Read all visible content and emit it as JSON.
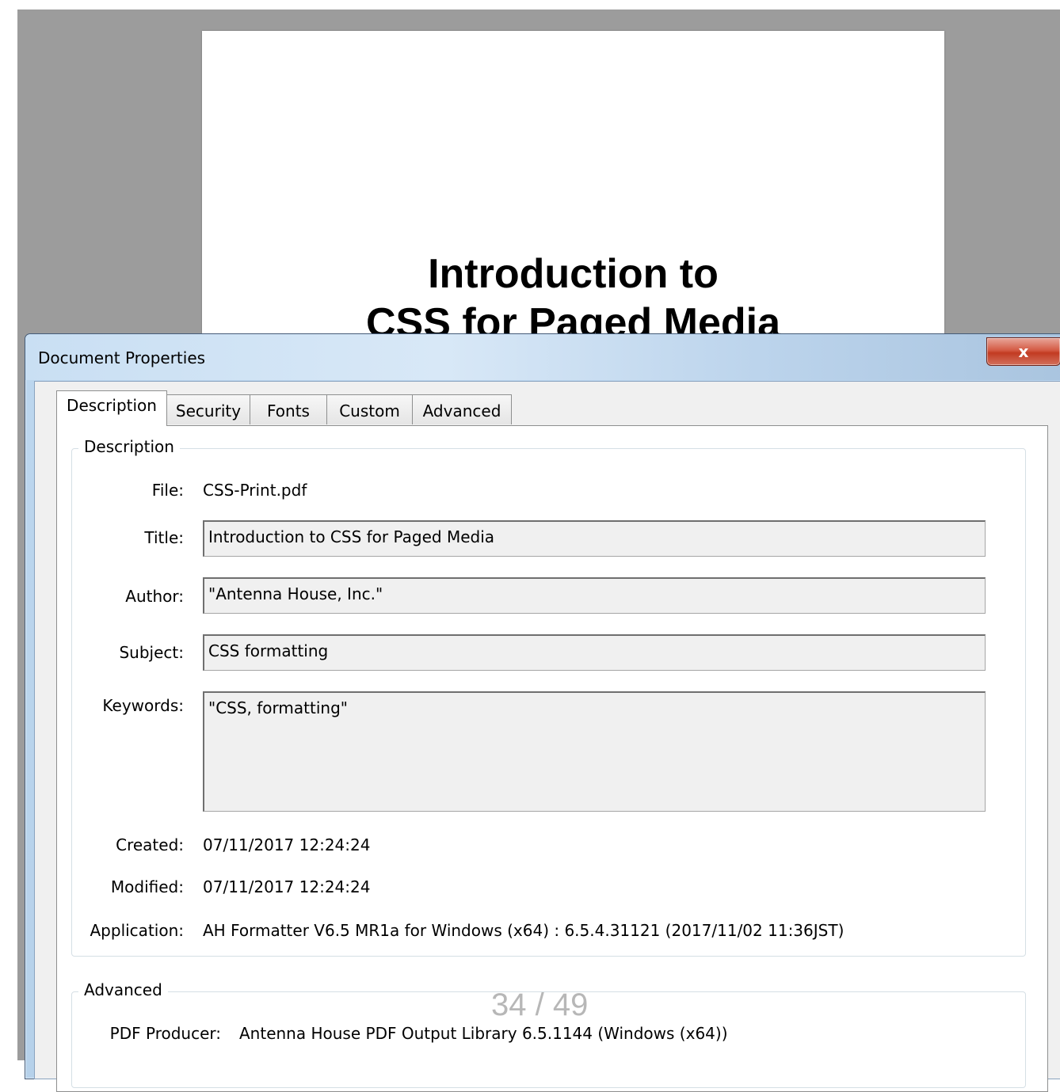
{
  "document": {
    "heading_line1": "Introduction to",
    "heading_line2": "CSS for Paged Media"
  },
  "dialog": {
    "title": "Document Properties",
    "close_label": "x"
  },
  "tabs": [
    {
      "label": "Description",
      "active": true
    },
    {
      "label": "Security",
      "active": false
    },
    {
      "label": "Fonts",
      "active": false
    },
    {
      "label": "Custom",
      "active": false
    },
    {
      "label": "Advanced",
      "active": false
    }
  ],
  "description_group": {
    "legend": "Description",
    "file_label": "File:",
    "file_value": "CSS-Print.pdf",
    "title_label": "Title:",
    "title_value": "Introduction to CSS for Paged Media",
    "author_label": "Author:",
    "author_value": "\"Antenna House, Inc.\"",
    "subject_label": "Subject:",
    "subject_value": "CSS formatting",
    "keywords_label": "Keywords:",
    "keywords_value": "\"CSS, formatting\"",
    "created_label": "Created:",
    "created_value": "07/11/2017 12:24:24",
    "modified_label": "Modified:",
    "modified_value": "07/11/2017 12:24:24",
    "application_label": "Application:",
    "application_value": "AH Formatter V6.5 MR1a for Windows (x64) : 6.5.4.31121 (2017/11/02 11:36JST)"
  },
  "advanced_group": {
    "legend": "Advanced",
    "producer_label": "PDF Producer:",
    "producer_value": "Antenna House PDF Output Library 6.5.1144 (Windows (x64))"
  },
  "page_counter": "34 / 49",
  "colors": {
    "viewer_background": "#9c9c9c",
    "close_button": "#c8462c",
    "titlebar": "#c9dff3"
  }
}
